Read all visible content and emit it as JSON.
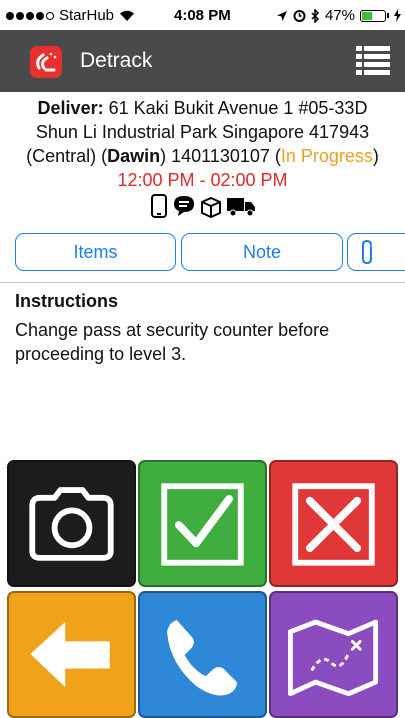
{
  "status_bar": {
    "carrier": "StarHub",
    "time": "4:08 PM",
    "battery": "47%",
    "battery_level": 0.47
  },
  "header": {
    "app_name": "Detrack",
    "logo_icon": "detrack-logo-icon",
    "menu_icon": "list-menu-icon"
  },
  "delivery": {
    "type_label": "Deliver:",
    "address_line1": " 61 Kaki Bukit Avenue 1 #05-33D",
    "address_line2": "Shun Li Industrial Park Singapore 417943",
    "zone_prefix": "(Central) (",
    "driver": "Dawin",
    "tracking_suffix": ") 1401130107 (",
    "status": "In Progress",
    "status_close": ")",
    "time_window": "12:00 PM - 02:00 PM",
    "status_icons": [
      "phone-icon",
      "chat-icon",
      "package-icon",
      "truck-icon"
    ],
    "colors": {
      "status": "#f0a020",
      "time_window": "#e02a2a"
    }
  },
  "actions": {
    "items_label": "Items",
    "note_label": "Note",
    "attach_icon": "paperclip-icon",
    "accent": "#1f7cf0"
  },
  "instructions": {
    "title": "Instructions",
    "text": "Change pass at security counter before proceeding to level 3."
  },
  "tiles": [
    {
      "name": "camera",
      "icon": "camera-icon",
      "color": "#1c1c1c"
    },
    {
      "name": "complete",
      "icon": "checkmark-icon",
      "color": "#3fae3f"
    },
    {
      "name": "fail",
      "icon": "cross-icon",
      "color": "#e03838"
    },
    {
      "name": "back",
      "icon": "back-arrow-icon",
      "color": "#f0a21a"
    },
    {
      "name": "call",
      "icon": "phone-call-icon",
      "color": "#2f87d8"
    },
    {
      "name": "map",
      "icon": "map-icon",
      "color": "#8b4cc0"
    }
  ]
}
